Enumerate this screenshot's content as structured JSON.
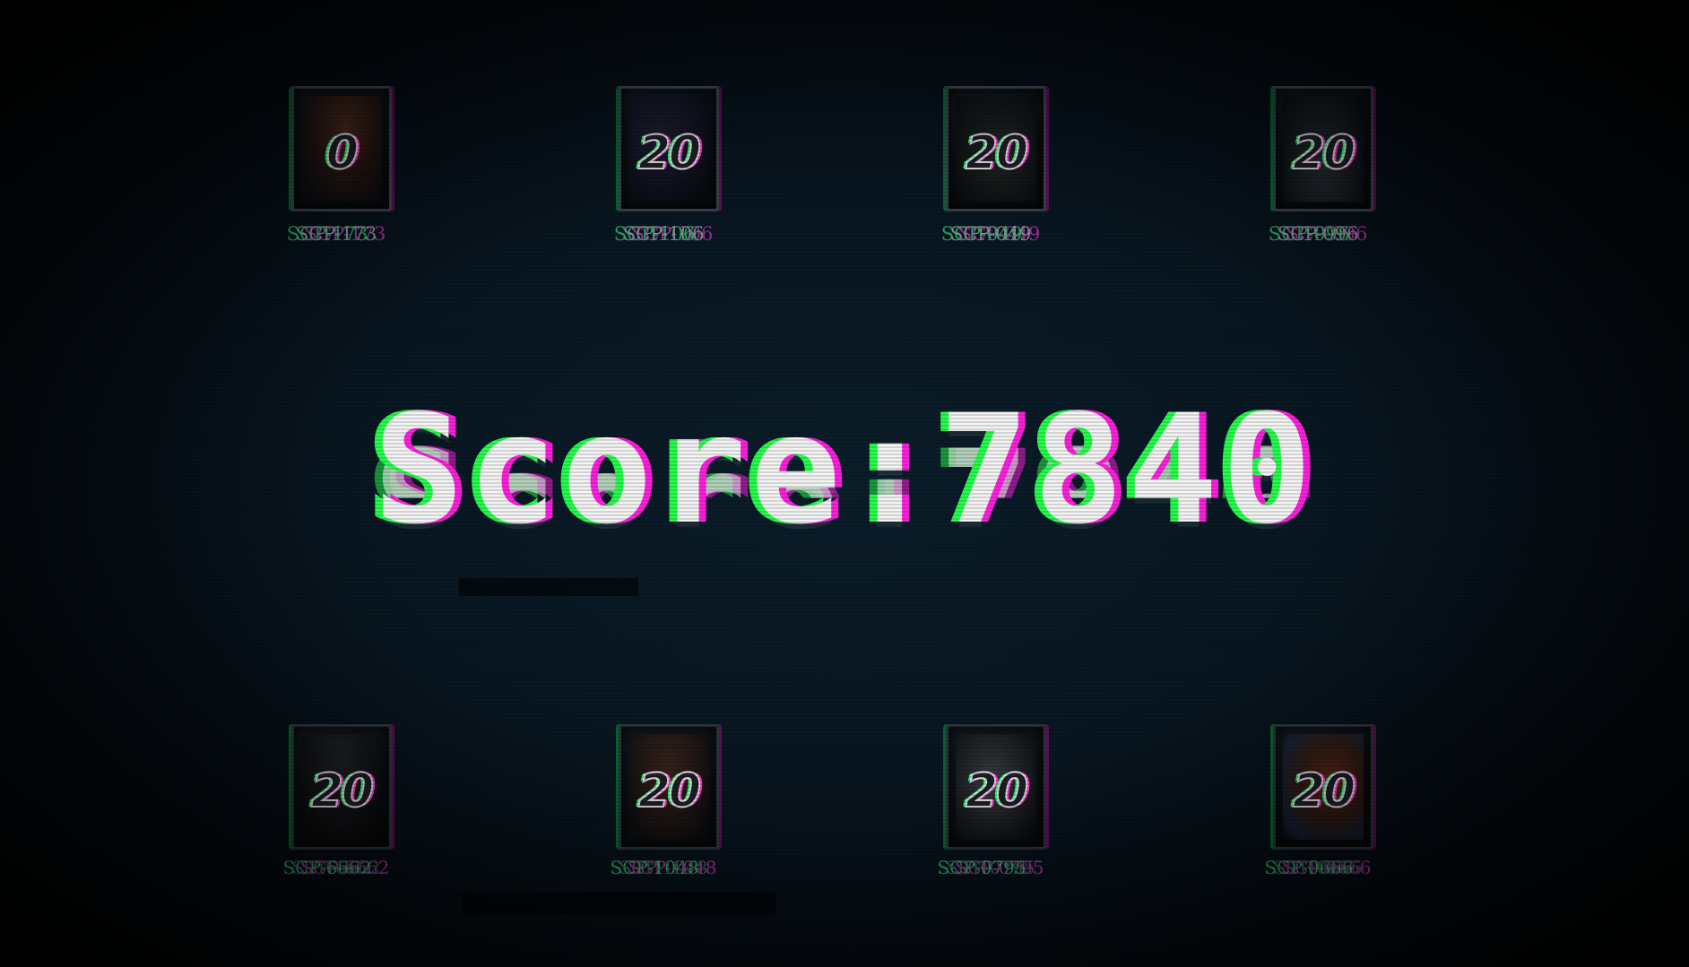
{
  "hud": {
    "score_text": "Score:7840"
  },
  "cards_top": [
    {
      "name": "SCP-173",
      "cost": "0",
      "art_color": "#7a3a1c"
    },
    {
      "name": "SCP-106",
      "cost": "20",
      "art_color": "#1d1a2e"
    },
    {
      "name": "SCP-049",
      "cost": "20",
      "art_color": "#1a1f1c"
    },
    {
      "name": "SCP-096",
      "cost": "20",
      "art_color": "#22282e"
    }
  ],
  "cards_bottom": [
    {
      "name": "SCP-6662",
      "cost": "20",
      "art_color": "#1a1a1a"
    },
    {
      "name": "SCP-1048",
      "cost": "20",
      "art_color": "#5a2a1a"
    },
    {
      "name": "SCP-0795",
      "cost": "20",
      "art_color": "#3a3d3f"
    },
    {
      "name": "SCP-0666",
      "cost": "20",
      "art_color": "#8a2a1a"
    }
  ],
  "colors": {
    "glitch_green": "#24ff4a",
    "glitch_magenta": "#ff1fe0",
    "background": "#081722"
  }
}
